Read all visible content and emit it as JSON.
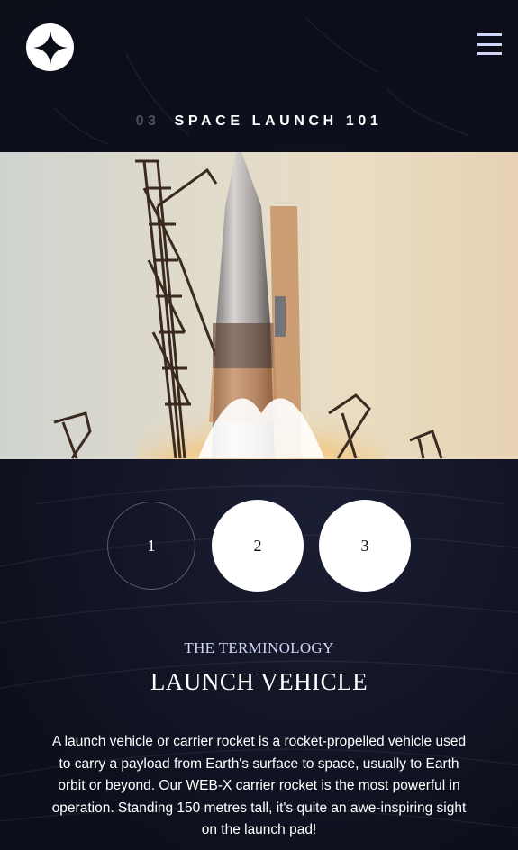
{
  "header": {
    "logo_icon": "star-logo-icon",
    "menu_icon": "hamburger-menu-icon"
  },
  "page": {
    "number": "03",
    "title": "SPACE LAUNCH 101"
  },
  "hero_image": {
    "subject": "rocket-launch-photo"
  },
  "steps": [
    {
      "label": "1",
      "state": "inactive"
    },
    {
      "label": "2",
      "state": "active"
    },
    {
      "label": "3",
      "state": "active"
    }
  ],
  "content": {
    "subheading": "THE TERMINOLOGY",
    "title": "LAUNCH VEHICLE",
    "description": "A launch vehicle or carrier rocket is a rocket-propelled vehicle used to carry a payload from Earth's surface to space, usually to Earth orbit or beyond. Our WEB-X carrier rocket is the most powerful in operation. Standing 150 metres tall, it's quite an awe-inspiring sight on the launch pad!"
  },
  "colors": {
    "background": "#0b0d17",
    "accent_light": "#d0d6f9",
    "white": "#ffffff",
    "muted": "#4c4f5c"
  }
}
